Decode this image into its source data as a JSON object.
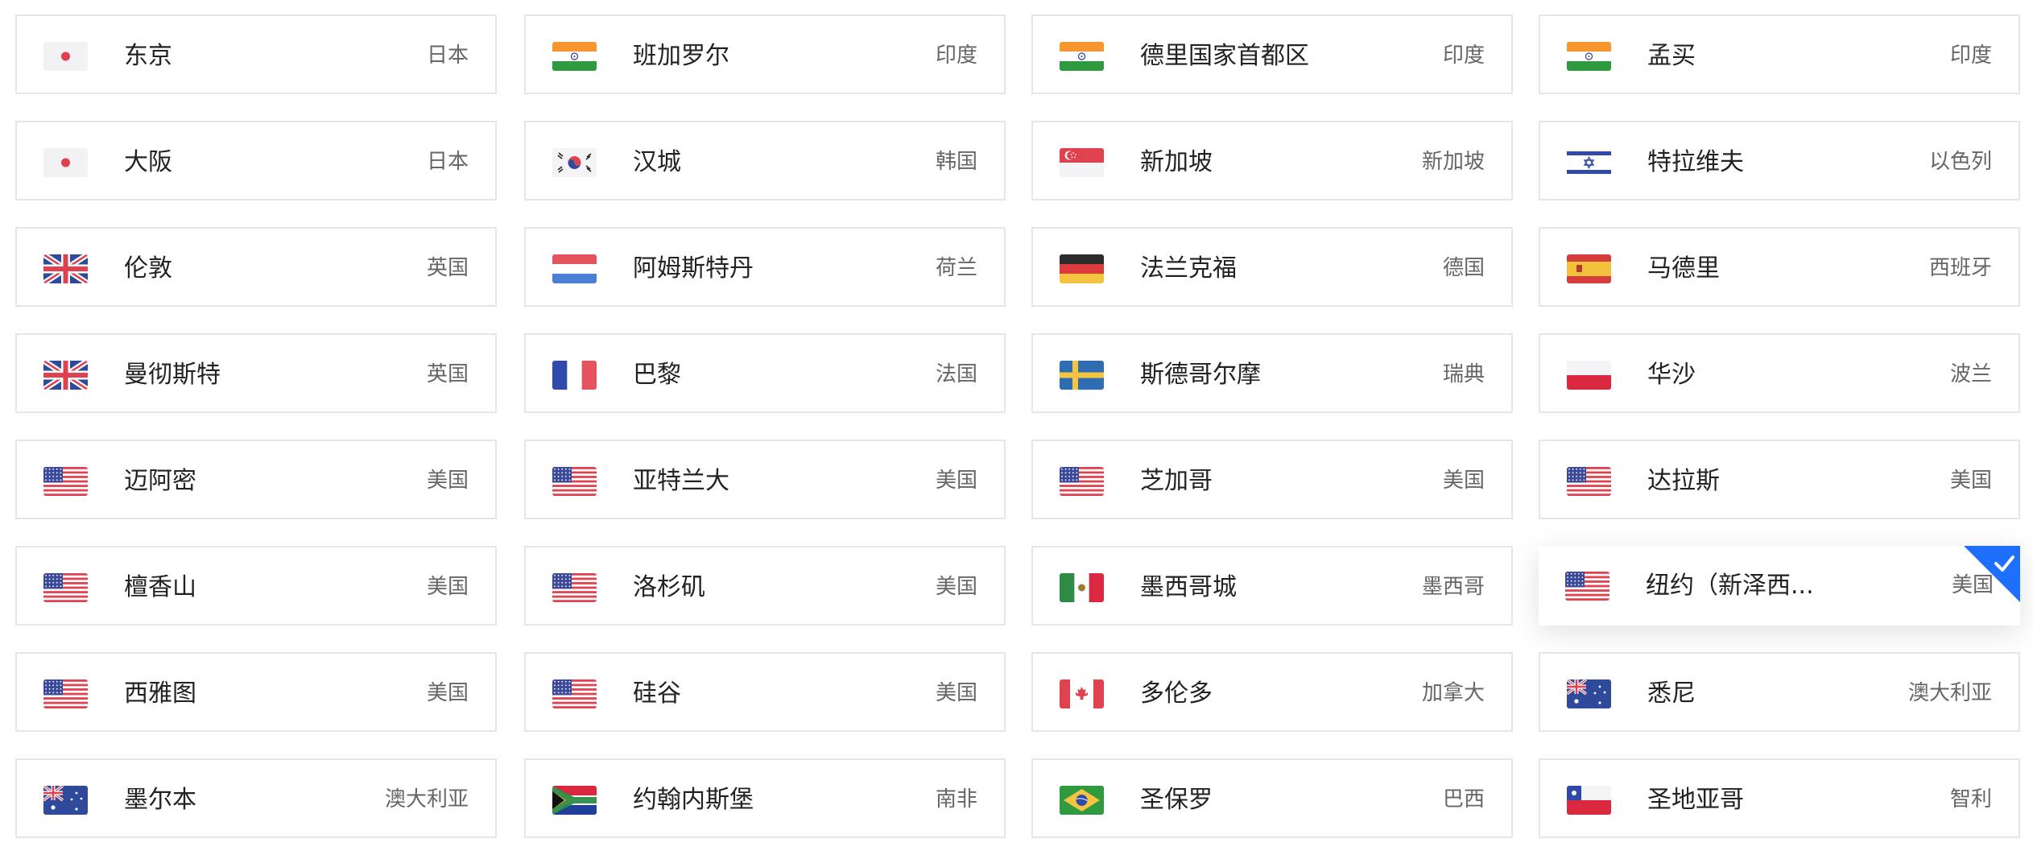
{
  "locations": [
    {
      "city": "东京",
      "country": "日本",
      "flag": "jp-flag-icon"
    },
    {
      "city": "班加罗尔",
      "country": "印度",
      "flag": "in-flag-icon"
    },
    {
      "city": "德里国家首都区",
      "country": "印度",
      "flag": "in-flag-icon"
    },
    {
      "city": "孟买",
      "country": "印度",
      "flag": "in-flag-icon"
    },
    {
      "city": "大阪",
      "country": "日本",
      "flag": "jp-flag-icon"
    },
    {
      "city": "汉城",
      "country": "韩国",
      "flag": "kr-flag-icon"
    },
    {
      "city": "新加坡",
      "country": "新加坡",
      "flag": "sg-flag-icon"
    },
    {
      "city": "特拉维夫",
      "country": "以色列",
      "flag": "il-flag-icon"
    },
    {
      "city": "伦敦",
      "country": "英国",
      "flag": "gb-flag-icon"
    },
    {
      "city": "阿姆斯特丹",
      "country": "荷兰",
      "flag": "nl-flag-icon"
    },
    {
      "city": "法兰克福",
      "country": "德国",
      "flag": "de-flag-icon"
    },
    {
      "city": "马德里",
      "country": "西班牙",
      "flag": "es-flag-icon"
    },
    {
      "city": "曼彻斯特",
      "country": "英国",
      "flag": "gb-flag-icon"
    },
    {
      "city": "巴黎",
      "country": "法国",
      "flag": "fr-flag-icon"
    },
    {
      "city": "斯德哥尔摩",
      "country": "瑞典",
      "flag": "se-flag-icon"
    },
    {
      "city": "华沙",
      "country": "波兰",
      "flag": "pl-flag-icon"
    },
    {
      "city": "迈阿密",
      "country": "美国",
      "flag": "us-flag-icon"
    },
    {
      "city": "亚特兰大",
      "country": "美国",
      "flag": "us-flag-icon"
    },
    {
      "city": "芝加哥",
      "country": "美国",
      "flag": "us-flag-icon"
    },
    {
      "city": "达拉斯",
      "country": "美国",
      "flag": "us-flag-icon"
    },
    {
      "city": "檀香山",
      "country": "美国",
      "flag": "us-flag-icon"
    },
    {
      "city": "洛杉矶",
      "country": "美国",
      "flag": "us-flag-icon"
    },
    {
      "city": "墨西哥城",
      "country": "墨西哥",
      "flag": "mx-flag-icon"
    },
    {
      "city": "纽约（新泽西...",
      "country": "美国",
      "flag": "us-flag-icon",
      "selected": true
    },
    {
      "city": "西雅图",
      "country": "美国",
      "flag": "us-flag-icon"
    },
    {
      "city": "硅谷",
      "country": "美国",
      "flag": "us-flag-icon"
    },
    {
      "city": "多伦多",
      "country": "加拿大",
      "flag": "ca-flag-icon"
    },
    {
      "city": "悉尼",
      "country": "澳大利亚",
      "flag": "au-flag-icon"
    },
    {
      "city": "墨尔本",
      "country": "澳大利亚",
      "flag": "au-flag-icon"
    },
    {
      "city": "约翰内斯堡",
      "country": "南非",
      "flag": "za-flag-icon"
    },
    {
      "city": "圣保罗",
      "country": "巴西",
      "flag": "br-flag-icon"
    },
    {
      "city": "圣地亚哥",
      "country": "智利",
      "flag": "cl-flag-icon"
    }
  ],
  "accent_color": "#1f6fff",
  "selected_icon": "checkmark-icon"
}
